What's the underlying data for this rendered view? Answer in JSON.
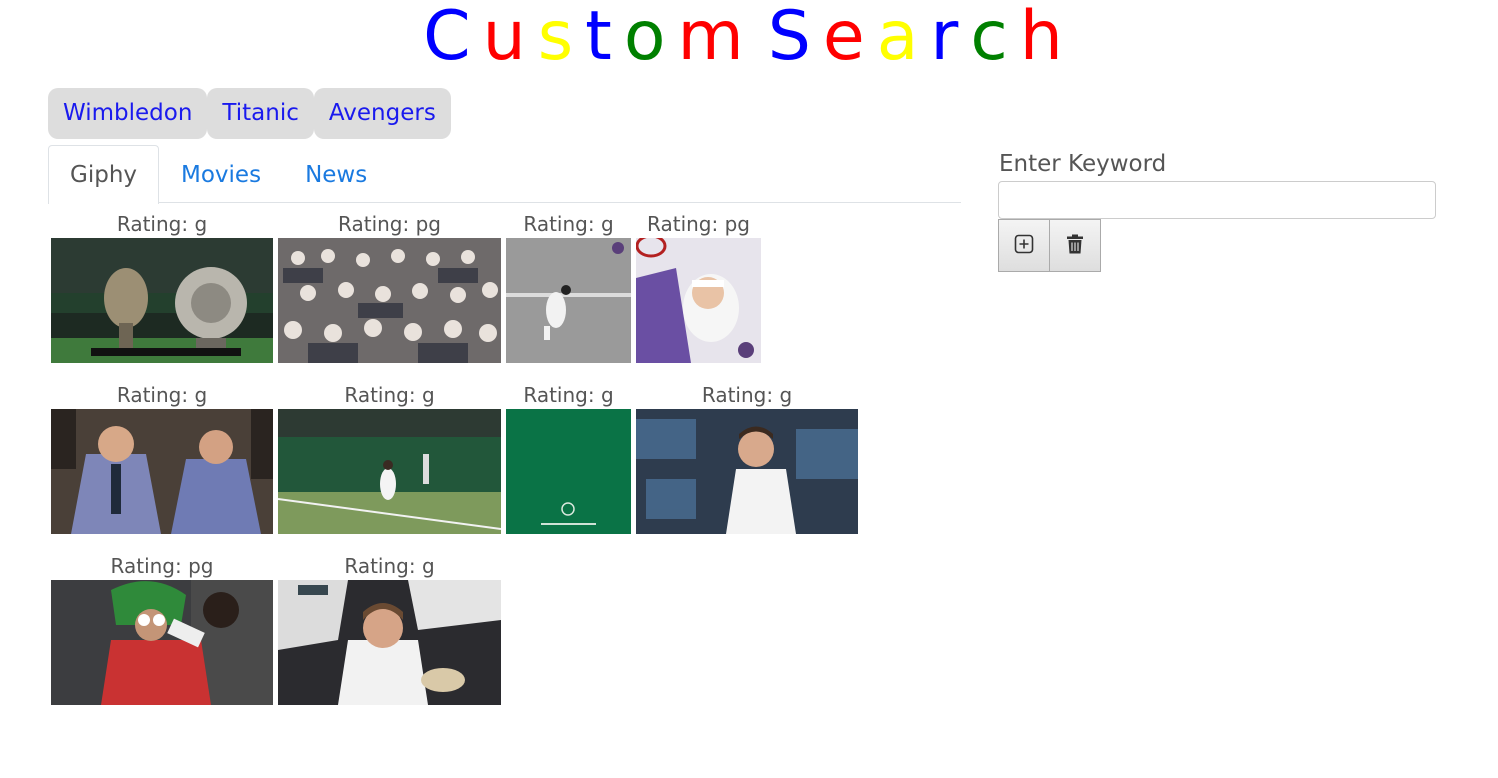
{
  "header": {
    "title_letters": [
      {
        "ch": "C",
        "color": "#0000ff"
      },
      {
        "ch": "u",
        "color": "#ff0000"
      },
      {
        "ch": "s",
        "color": "#ffff00"
      },
      {
        "ch": "t",
        "color": "#0000ff"
      },
      {
        "ch": "o",
        "color": "#008000"
      },
      {
        "ch": "m",
        "color": "#ff0000"
      },
      {
        "ch": " ",
        "color": "#000000"
      },
      {
        "ch": "S",
        "color": "#0000ff"
      },
      {
        "ch": "e",
        "color": "#ff0000"
      },
      {
        "ch": "a",
        "color": "#ffff00"
      },
      {
        "ch": "r",
        "color": "#0000ff"
      },
      {
        "ch": "c",
        "color": "#008000"
      },
      {
        "ch": "h",
        "color": "#ff0000"
      }
    ]
  },
  "topics": [
    "Wimbledon",
    "Titanic",
    "Avengers"
  ],
  "tabs": [
    {
      "label": "Giphy",
      "active": true
    },
    {
      "label": "Movies",
      "active": false
    },
    {
      "label": "News",
      "active": false
    }
  ],
  "gifs": [
    {
      "rating": "Rating: g",
      "alt": "trophies-on-court"
    },
    {
      "rating": "Rating: pg",
      "alt": "crowd-in-stands"
    },
    {
      "rating": "Rating: g",
      "alt": "player-lunging"
    },
    {
      "rating": "Rating: pg",
      "alt": "illustrated-serve"
    },
    {
      "rating": "Rating: g",
      "alt": "fans-celebrating"
    },
    {
      "rating": "Rating: g",
      "alt": "player-on-grass-court"
    },
    {
      "rating": "Rating: g",
      "alt": "wimbledon-green-logo"
    },
    {
      "rating": "Rating: g",
      "alt": "player-thinking"
    },
    {
      "rating": "Rating: pg",
      "alt": "strawberry-costume-fan"
    },
    {
      "rating": "Rating: g",
      "alt": "spectators-reacting"
    }
  ],
  "sidebar": {
    "keyword_label": "Enter Keyword",
    "keyword_value": "",
    "add_icon": "plus-square-icon",
    "delete_icon": "trash-icon"
  }
}
